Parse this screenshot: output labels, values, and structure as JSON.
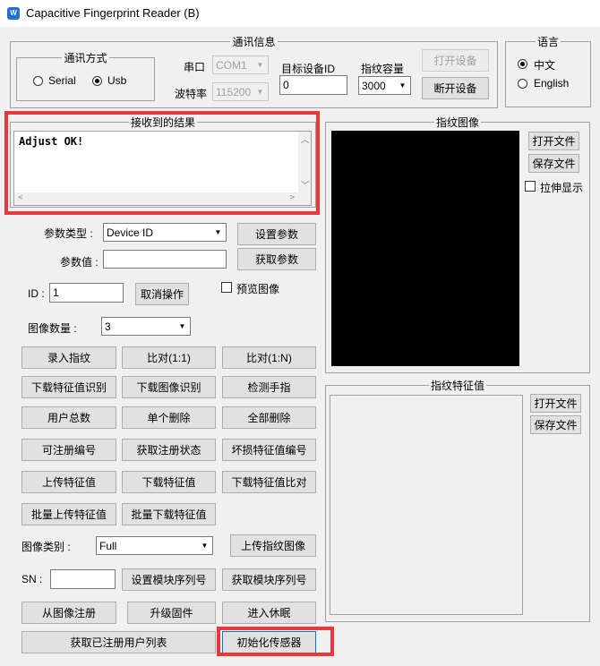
{
  "window": {
    "title": "Capacitive Fingerprint Reader (B)",
    "icon_text": "W"
  },
  "comm": {
    "legend": "通讯信息",
    "mode_legend": "通讯方式",
    "serial_label": "Serial",
    "usb_label": "Usb",
    "selected_mode": "Usb",
    "port_label": "串口",
    "port_value": "COM1",
    "baud_label": "波特率",
    "baud_value": "115200",
    "target_id_label": "目标设备ID",
    "target_id_value": "0",
    "capacity_label": "指纹容量",
    "capacity_value": "3000",
    "open_button": "打开设备",
    "close_button": "断开设备"
  },
  "language": {
    "legend": "语言",
    "chinese": "中文",
    "english": "English",
    "selected": "中文"
  },
  "result": {
    "legend": "接收到的结果",
    "text": "Adjust OK!"
  },
  "params": {
    "type_label": "参数类型 :",
    "type_value": "Device ID",
    "value_label": "参数值 :",
    "value_value": "",
    "set_button": "设置参数",
    "get_button": "获取参数"
  },
  "id_row": {
    "id_label": "ID :",
    "id_value": "1",
    "cancel_button": "取消操作",
    "preview_label": "预览图像"
  },
  "image_count": {
    "label": "图像数量 :",
    "value": "3"
  },
  "actions": {
    "enroll": "录入指纹",
    "match_1_1": "比对(1:1)",
    "match_1_n": "比对(1:N)",
    "download_feature_identify": "下载特征值识别",
    "download_image_identify": "下载图像识别",
    "detect_finger": "检测手指",
    "user_count": "用户总数",
    "delete_single": "单个删除",
    "delete_all": "全部删除",
    "enrollable_number": "可注册编号",
    "get_enroll_status": "获取注册状态",
    "bad_feature_number": "坏损特征值编号",
    "upload_feature": "上传特征值",
    "download_feature": "下载特征值",
    "download_feature_compare": "下载特征值比对",
    "batch_upload_feature": "批量上传特征值",
    "batch_download_feature": "批量下载特征值"
  },
  "image_type": {
    "label": "图像类别 :",
    "value": "Full",
    "upload_button": "上传指纹图像"
  },
  "sn": {
    "label": "SN :",
    "value": "",
    "set_button": "设置模块序列号",
    "get_button": "获取模块序列号"
  },
  "bottom": {
    "enroll_from_image": "从图像注册",
    "upgrade_firmware": "升级固件",
    "sleep": "进入休眠",
    "get_user_list": "获取已注册用户列表",
    "init_sensor": "初始化传感器"
  },
  "fp_image": {
    "legend": "指纹图像",
    "open_file": "打开文件",
    "save_file": "保存文件",
    "stretch_label": "拉伸显示"
  },
  "fp_feature": {
    "legend": "指纹特征值",
    "open_file": "打开文件",
    "save_file": "保存文件"
  },
  "colors": {
    "highlight": "#e8383a",
    "image_bg": "#000000",
    "window_bg": "#f0f0f0"
  }
}
